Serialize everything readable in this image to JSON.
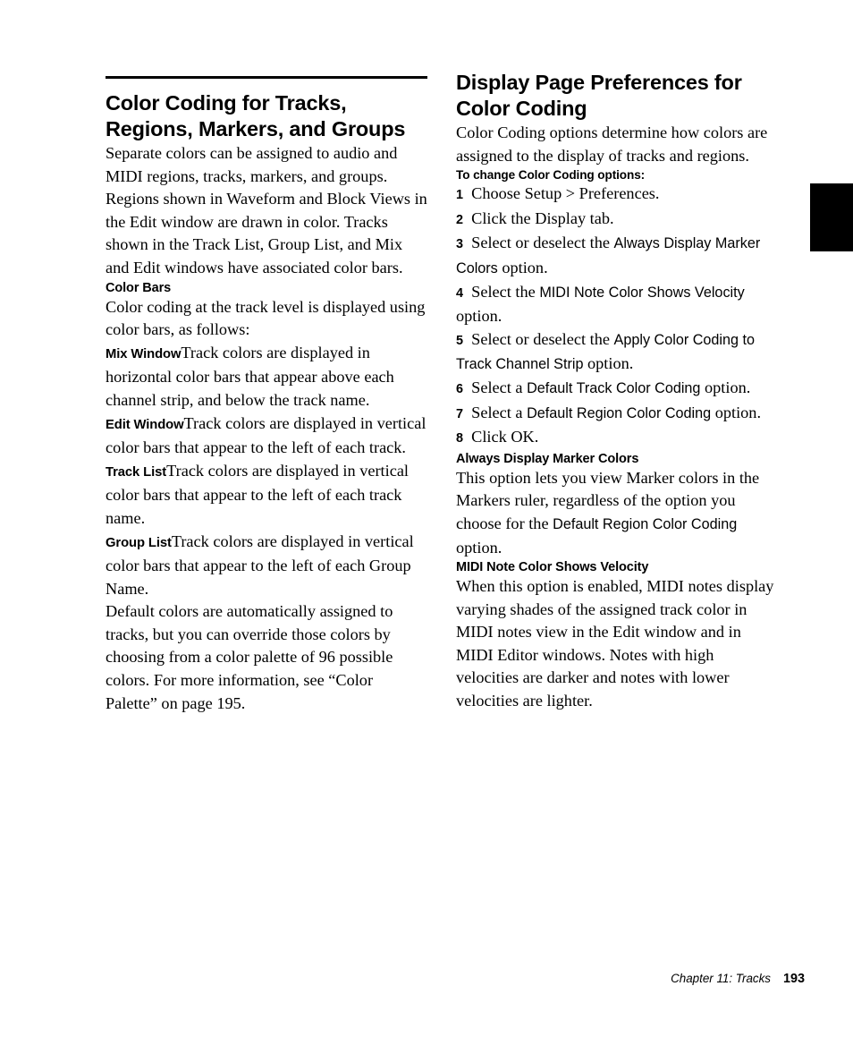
{
  "page": {
    "number": "193",
    "chapter_label": "Chapter 11: Tracks",
    "thumb_tab_color": "#000000"
  },
  "left_column": {
    "title": "Color Coding for Tracks, Regions, Markers, and Groups",
    "intro": "Separate colors can be assigned to audio and MIDI regions, tracks, markers, and groups. Regions shown in Waveform and Block Views in the Edit window are drawn in color. Tracks shown in the Track List, Group List, and Mix and Edit windows have associated color bars.",
    "color_bars_heading": "Color Bars",
    "color_bars_intro": "Color coding at the track level is displayed using color bars, as follows:",
    "definitions": [
      {
        "term": "Mix Window",
        "text": "Track colors are displayed in horizontal color bars that appear above each channel strip, and below the track name."
      },
      {
        "term": "Edit Window",
        "text": "Track colors are displayed in vertical color bars that appear to the left of each track."
      },
      {
        "term": "Track List",
        "text": "Track colors are displayed in vertical color bars that appear to the left of each track name."
      },
      {
        "term": "Group List",
        "text": "Track colors are displayed in vertical color bars that appear to the left of each Group Name."
      }
    ],
    "closing": "Default colors are automatically assigned to tracks, but you can override those colors by choosing from a color palette of 96 possible colors. For more information, see “Color Palette” on page 195."
  },
  "right_column": {
    "title": "Display Page Preferences for Color Coding",
    "intro": "Color Coding options determine how colors are assigned to the display of tracks and regions.",
    "procedure_heading": "To change Color Coding options:",
    "steps": [
      {
        "num": "1",
        "pre": "Choose Setup > Preferences.",
        "ui": "",
        "post": ""
      },
      {
        "num": "2",
        "pre": "Click the Display tab.",
        "ui": "",
        "post": ""
      },
      {
        "num": "3",
        "pre": "Select or deselect the ",
        "ui": "Always Display Marker Colors",
        "post": " option."
      },
      {
        "num": "4",
        "pre": "Select the ",
        "ui": "MIDI Note Color Shows Velocity",
        "post": " option."
      },
      {
        "num": "5",
        "pre": "Select or deselect the ",
        "ui": "Apply Color Coding to Track Channel Strip",
        "post": " option."
      },
      {
        "num": "6",
        "pre": "Select a ",
        "ui": "Default Track Color Coding",
        "post": " option."
      },
      {
        "num": "7",
        "pre": "Select a ",
        "ui": "Default Region Color Coding",
        "post": " option."
      },
      {
        "num": "8",
        "pre": "Click OK.",
        "ui": "",
        "post": ""
      }
    ],
    "marker_colors_heading": "Always Display Marker Colors",
    "marker_colors_pre": "This option lets you view Marker colors in the Markers ruler, regardless of the option you choose for the ",
    "marker_colors_ui": "Default Region Color Coding",
    "marker_colors_post": " option.",
    "velocity_heading": "MIDI Note Color Shows Velocity",
    "velocity_body": "When this option is enabled, MIDI notes display varying shades of the assigned track color in MIDI notes view in the Edit window and in MIDI Editor windows. Notes with high velocities are darker and notes with lower velocities are lighter."
  }
}
